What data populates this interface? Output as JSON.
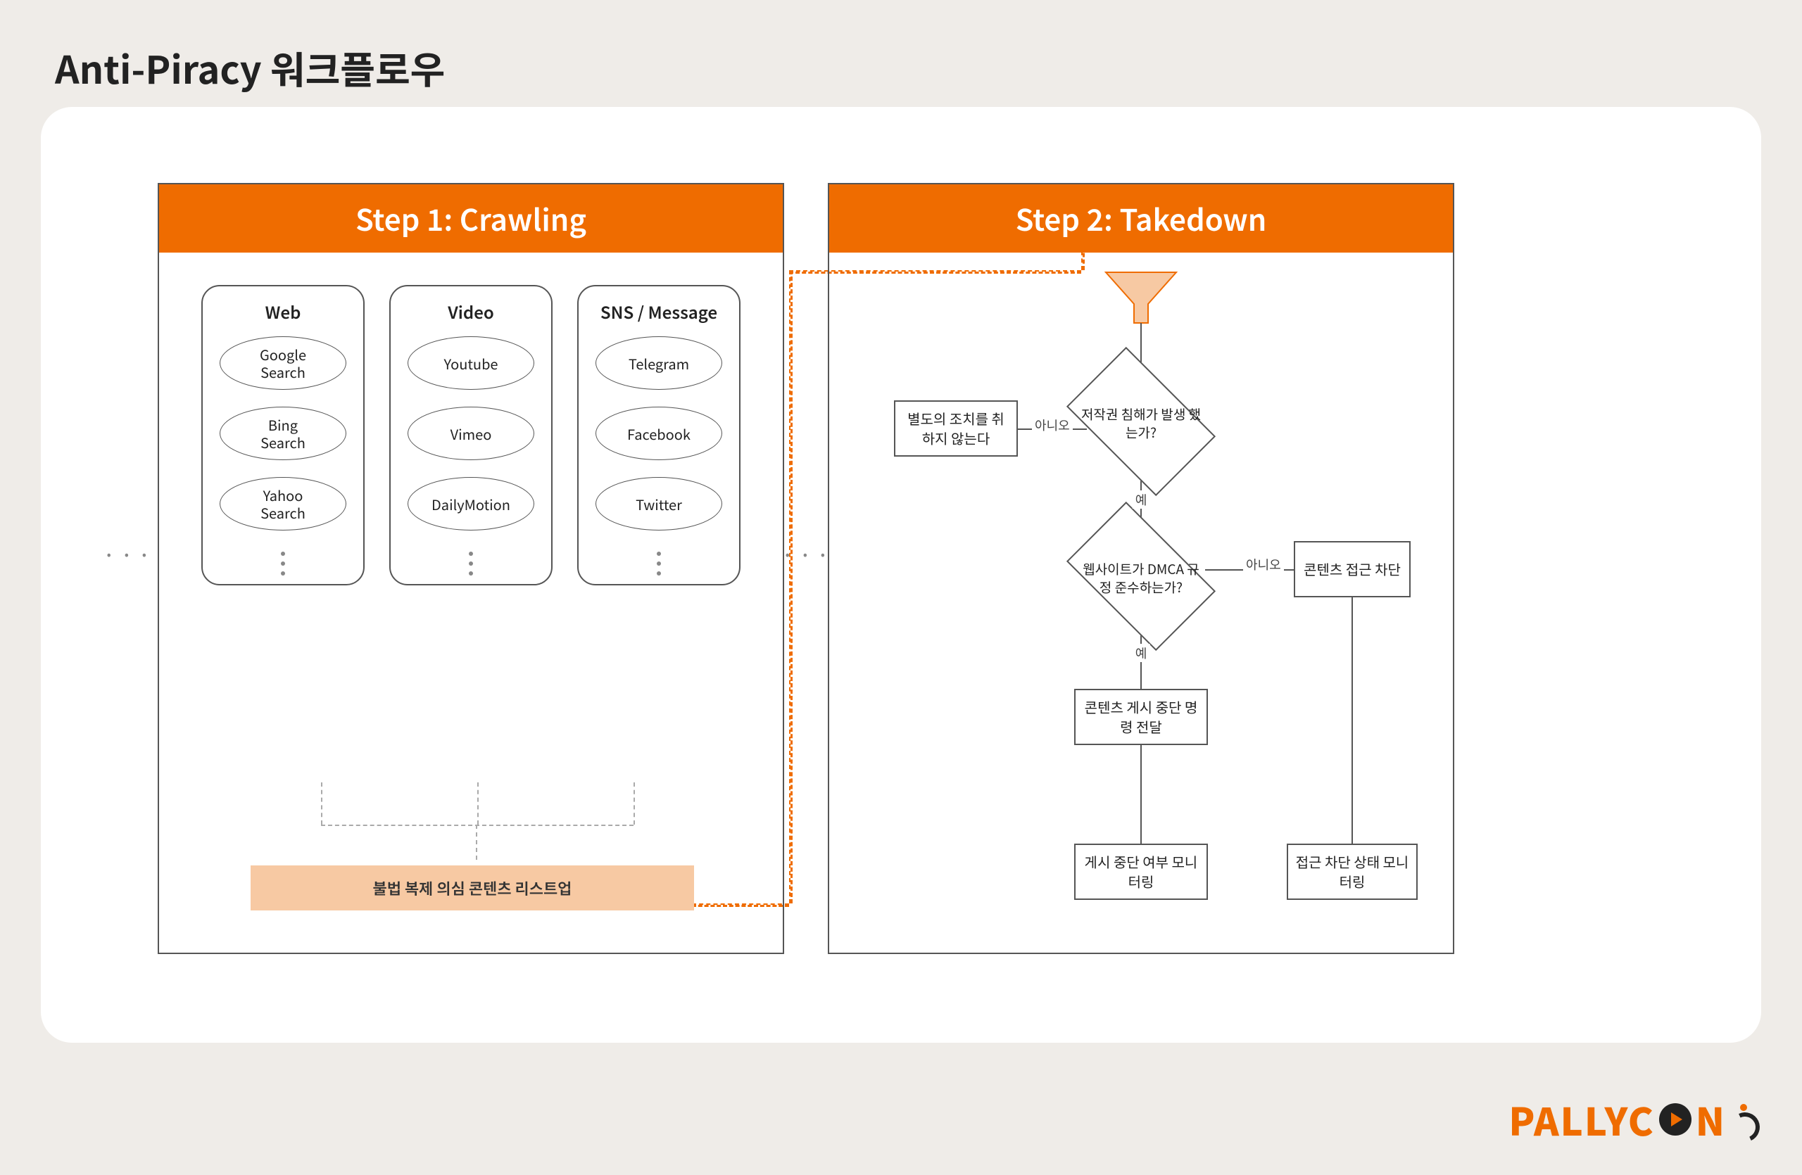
{
  "title": "Anti-Piracy 워크플로우",
  "brand": "PALLYCON",
  "step1": {
    "header": "Step 1: Crawling",
    "columns": [
      {
        "title": "Web",
        "items": [
          "Google\nSearch",
          "Bing\nSearch",
          "Yahoo\nSearch"
        ]
      },
      {
        "title": "Video",
        "items": [
          "Youtube",
          "Vimeo",
          "DailyMotion"
        ]
      },
      {
        "title": "SNS / Message",
        "items": [
          "Telegram",
          "Facebook",
          "Twitter"
        ]
      }
    ],
    "listup": "불법 복제 의심 콘텐츠 리스트업"
  },
  "step2": {
    "header": "Step 2: Takedown",
    "decisions": {
      "d1": "저작권 침해가\n발생 했는가?",
      "d2": "웹사이트가 DMCA\n규정 준수하는가?"
    },
    "labels": {
      "yes": "예",
      "no": "아니오"
    },
    "boxes": {
      "noaction": "별도의 조치를\n취하지 않는다",
      "block": "콘텐츠\n접근 차단",
      "order": "콘텐츠 게시 중단\n명령 전달",
      "monitor_left": "게시 중단 여부\n모니터링",
      "monitor_right": "접근 차단 상태\n모니터링"
    }
  }
}
